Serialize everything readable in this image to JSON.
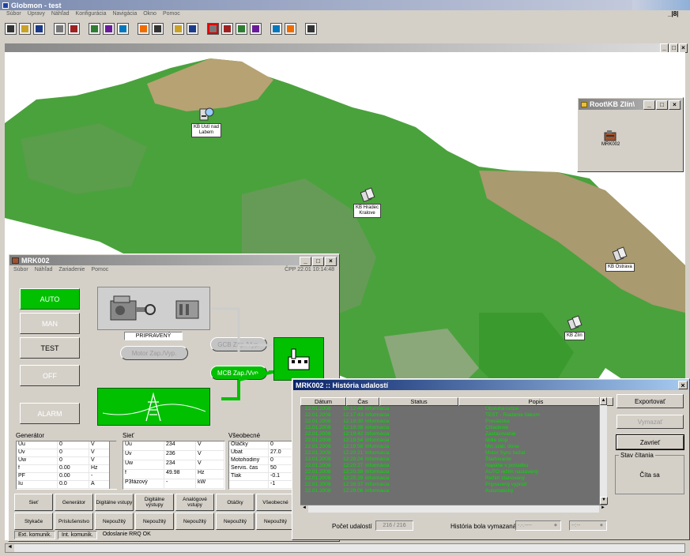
{
  "app": {
    "title": "Globmon - test",
    "menu": [
      "Súbor",
      "Úpravy",
      "Náhľad",
      "Konfigurácia",
      "Navigácia",
      "Okno",
      "Pomoc"
    ],
    "restore_label": "_|8|",
    "toolbar_icons": [
      "new-icon",
      "open-icon",
      "save-icon",
      "window-icon",
      "close-doc-icon",
      "user-add-icon",
      "user-icon",
      "tile-icon",
      "cascade-icon",
      "zoom-in-icon",
      "zoom-out-icon",
      "settings-icon",
      "alarm-icon",
      "report-icon",
      "chart-icon",
      "stack-icon",
      "network-icon",
      "export-icon",
      "info-icon"
    ]
  },
  "map": {
    "colors": {
      "lowland": "#3a9a2e",
      "highland": "#8aa87a",
      "mountain": "#c9b98f",
      "background": "#ffffff"
    },
    "sites": [
      {
        "id": "usti",
        "label": "KB Ústí nad\nLabem"
      },
      {
        "id": "hradec",
        "label": "KB Hradec\nKralove"
      },
      {
        "id": "ostrava",
        "label": "KB Ostrava"
      },
      {
        "id": "zlin",
        "label": "KB Zlín"
      }
    ]
  },
  "root_window": {
    "title": "Root\\KB Zlín\\",
    "item_label": "MRK002"
  },
  "mrk": {
    "title": "MRK002",
    "menu": [
      "Súbor",
      "Náhľad",
      "Zariadenie",
      "Pomoc"
    ],
    "status_time": "ČPP 22.01 10:14:48",
    "modes": [
      {
        "label": "AUTO",
        "active": true
      },
      {
        "label": "MAN",
        "active": false
      },
      {
        "label": "TEST",
        "active": false
      },
      {
        "label": "OFF",
        "active": false
      },
      {
        "label": "ALARM",
        "active": false
      }
    ],
    "state_label": "PRIPRAVENÝ",
    "motor_button": "Motor Zap./Vyp.",
    "gcb_button": "GCB Zap./Vyp.",
    "mcb_button": "MCB Zap./Vyp.",
    "accent_green": "#00c000",
    "generator": {
      "title": "Generátor",
      "rows": [
        [
          "Uu",
          "0",
          "V"
        ],
        [
          "Uv",
          "0",
          "V"
        ],
        [
          "Uw",
          "0",
          "V"
        ],
        [
          "f",
          "0.00",
          "Hz"
        ],
        [
          "PF",
          "0.00",
          "-"
        ],
        [
          "Iu",
          "0.0",
          "A"
        ]
      ]
    },
    "grid": {
      "title": "Sieť",
      "rows": [
        [
          "Uu",
          "234",
          "V"
        ],
        [
          "Uv",
          "236",
          "V"
        ],
        [
          "Uw",
          "234",
          "V"
        ],
        [
          "f",
          "49.98",
          "Hz"
        ],
        [
          "P3fázový",
          "-",
          "kW"
        ]
      ]
    },
    "general": {
      "title": "Všeobecné",
      "rows": [
        [
          "Otáčky",
          "0"
        ],
        [
          "Ubat",
          "27.0"
        ],
        [
          "Motohodiny",
          "0"
        ],
        [
          "Servis. čas",
          "50"
        ],
        [
          "Tlak",
          "-0.1"
        ],
        [
          "",
          "-1"
        ]
      ]
    },
    "tabs_row1": [
      "Sieť",
      "Generátor",
      "Digitálne vstupy",
      "Digitálne výstupy",
      "Analógové vstupy",
      "Otáčky",
      "Všeobecné"
    ],
    "tabs_row2": [
      "Stykače",
      "Príslušenstvo",
      "Nepoužitý",
      "Nepoužitý",
      "Nepoužitý",
      "Nepoužitý",
      "Nepoužitý"
    ],
    "statusbar": [
      "Ext. komunik.",
      "Int. komunik.",
      "Odoslanie RRQ OK"
    ]
  },
  "history": {
    "title": "MRK002 :: História udalostí",
    "columns": [
      "Dátum",
      "Čas",
      "Status",
      "Popis"
    ],
    "rows": [
      [
        "22.01.2008",
        "10:12:48",
        "Informácia",
        "Obsluha ručne"
      ],
      [
        "22.01.2008",
        "12:17:43",
        "Informácia",
        "TEST - Riadenie tlakom"
      ],
      [
        "22.01.2008",
        "12:19:30",
        "Informácia",
        "Prevádzka"
      ],
      [
        "22.01.2008",
        "12:19:38",
        "Informácia",
        "Chladenie"
      ],
      [
        "22.01.2008",
        "12:19:42",
        "Informácia",
        "Zastavovanie"
      ],
      [
        "22.01.2008",
        "12:19:54",
        "Informácia",
        "Iddle stop"
      ],
      [
        "22.01.2008",
        "12:19:58",
        "Informácia",
        "Min.stab. done"
      ],
      [
        "22.01.2008",
        "12:20:21",
        "Informácia",
        "Motor Sync bežal"
      ],
      [
        "22.01.2008",
        "12:20:24",
        "Informácia",
        "Štartovanie"
      ],
      [
        "22.01.2008",
        "12:20:27",
        "Informácia",
        "Napätie v poriadku"
      ],
      [
        "22.01.2008",
        "12:20:38",
        "Informácia",
        "AUTO režim nastavený"
      ],
      [
        "22.01.2008",
        "12:25:29",
        "Informácia",
        "Režim stanovený"
      ],
      [
        "22.01.2008",
        "12:28:37",
        "Informácia",
        "Pripravený vypnúť"
      ],
      [
        "22.01.2008",
        "12:29:06",
        "Informácia",
        "Automatický"
      ]
    ],
    "count_label": "Počet udalostí",
    "count_value": "216 / 216",
    "deleted_label": "História bola vymazaná",
    "date_placeholder": "-.-.----",
    "time_placeholder": "--:--",
    "export_button": "Exportovať",
    "delete_button": "Vymazať",
    "close_button": "Zavrieť",
    "read_state_title": "Stav čítania",
    "read_state_value": "Číta sa"
  }
}
